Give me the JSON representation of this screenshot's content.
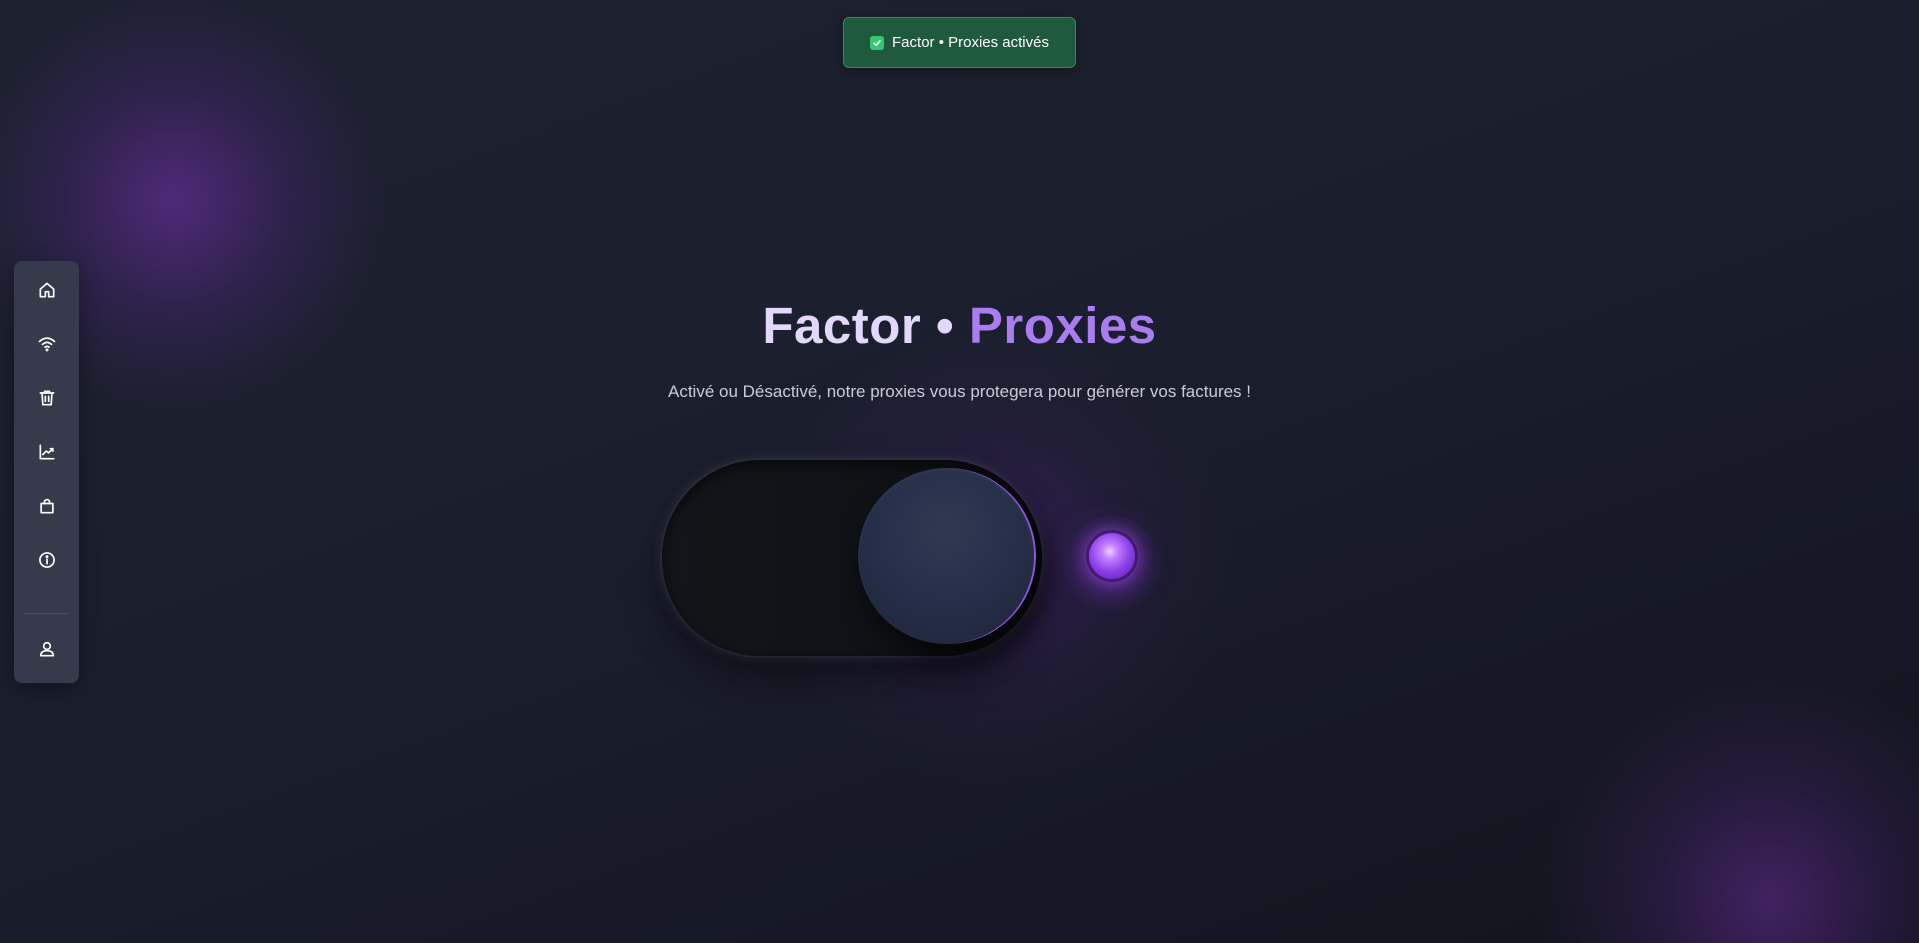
{
  "toast": {
    "message": "Factor • Proxies activés",
    "icon": "check-icon",
    "background": "#1f5a3d",
    "check_color": "#31c773"
  },
  "sidebar": {
    "items": [
      {
        "name": "home",
        "icon": "home-icon"
      },
      {
        "name": "wifi",
        "icon": "wifi-icon"
      },
      {
        "name": "trash",
        "icon": "trash-icon"
      },
      {
        "name": "stats",
        "icon": "chart-line-icon"
      },
      {
        "name": "shop",
        "icon": "shopping-bag-icon"
      },
      {
        "name": "info",
        "icon": "info-icon"
      }
    ],
    "footer_item": {
      "name": "profile",
      "icon": "user-icon"
    }
  },
  "hero": {
    "title_part1": "Factor • ",
    "title_part2": "Proxies",
    "subtitle": "Activé ou Désactivé, notre proxies vous protegera pour générer vos factures !"
  },
  "toggle": {
    "state": "on",
    "indicator_color": "#9b4ef0"
  },
  "colors": {
    "accent": "#a97cf0",
    "title_light": "#e3d8fb",
    "sidebar_bg": "#363b4b",
    "page_bg": "#1b1f2d"
  }
}
